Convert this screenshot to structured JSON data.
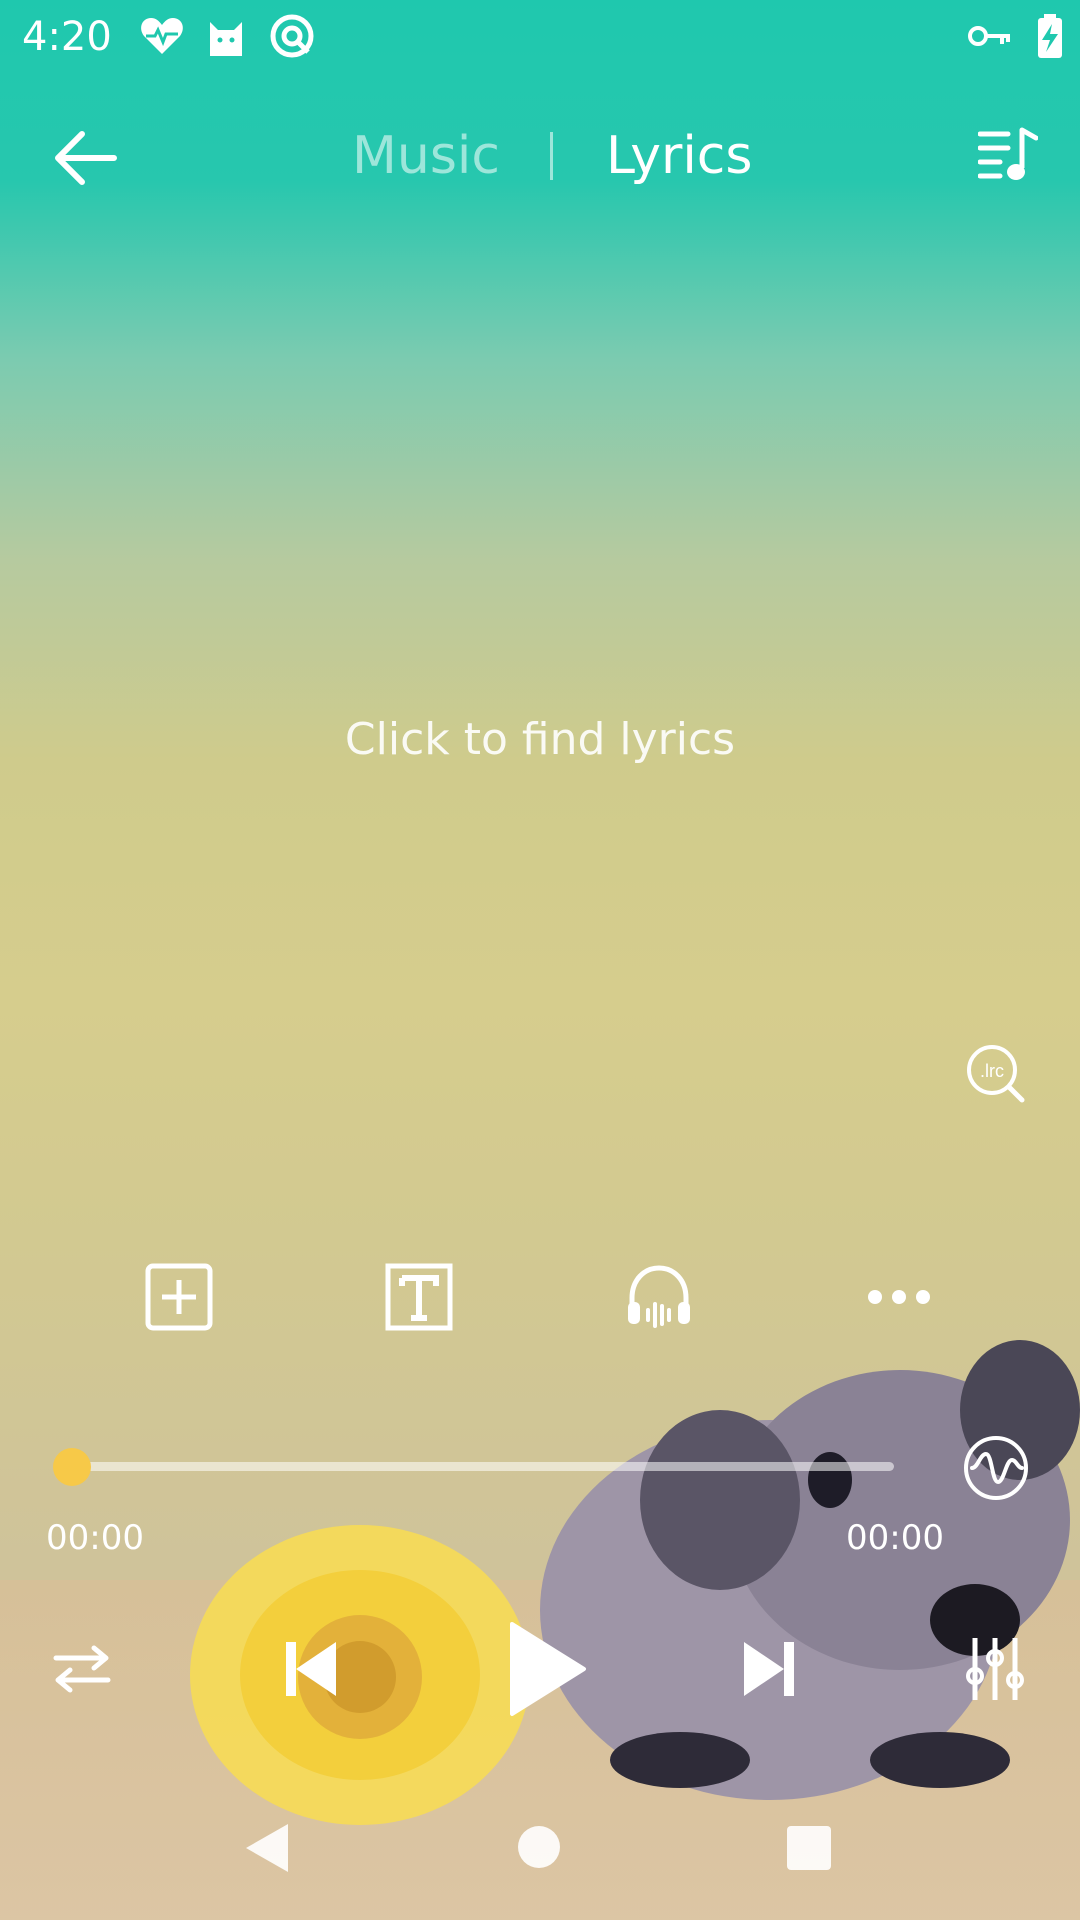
{
  "status_bar": {
    "time": "4:20",
    "left_icons": [
      "heart-pulse-icon",
      "cat-icon",
      "vpn-circle-icon"
    ],
    "right_icons": [
      "key-icon",
      "battery-charging-icon"
    ]
  },
  "header": {
    "back_icon": "arrow-left-icon",
    "tabs": [
      {
        "label": "Music",
        "active": false
      },
      {
        "label": "Lyrics",
        "active": true
      }
    ],
    "queue_icon": "playlist-music-icon"
  },
  "lyrics": {
    "empty_prompt": "Click to find lyrics",
    "search_badge": ".lrc"
  },
  "actions": [
    {
      "name": "add-to-playlist",
      "icon": "add-box-icon"
    },
    {
      "name": "lyrics-text",
      "icon": "text-box-icon"
    },
    {
      "name": "audio-effects",
      "icon": "headphones-wave-icon"
    },
    {
      "name": "more",
      "icon": "more-dots-icon"
    }
  ],
  "progress": {
    "current": "00:00",
    "total": "00:00",
    "fraction": 0.0,
    "thumb_color": "#f7c948"
  },
  "controls": {
    "repeat_icon": "repeat-icon",
    "prev_icon": "skip-previous-icon",
    "play_icon": "play-icon",
    "next_icon": "skip-next-icon",
    "equalizer_icon": "equalizer-icon",
    "visualizer_icon": "waveform-circle-icon"
  },
  "nav_bar": [
    "nav-back-icon",
    "nav-home-icon",
    "nav-recents-icon"
  ],
  "colors": {
    "accent": "#f7c948",
    "top_gradient": "#1fc8ae",
    "text": "#ffffff"
  }
}
